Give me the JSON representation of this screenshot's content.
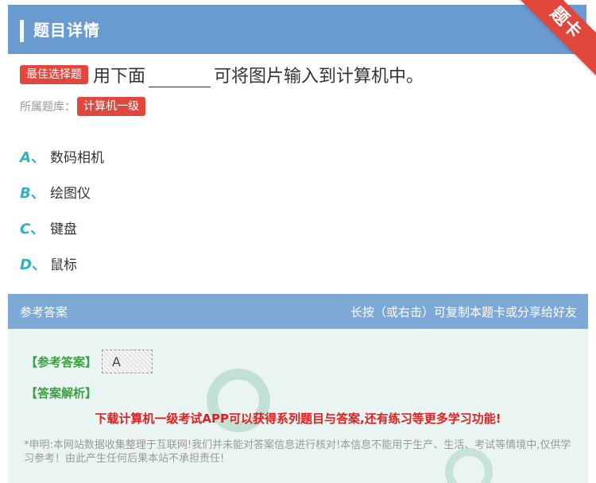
{
  "header": {
    "title": "题目详情",
    "ribbon": "题卡"
  },
  "question": {
    "type_tag": "最佳选择题",
    "text_before": "用下面",
    "text_after": "可将图片输入到计算机中。",
    "source_label": "所属题库：",
    "source_tag": "计算机一级"
  },
  "options": [
    {
      "letter": "A",
      "sep": "、",
      "text": "数码相机"
    },
    {
      "letter": "B",
      "sep": "、",
      "text": "绘图仪"
    },
    {
      "letter": "C",
      "sep": "、",
      "text": "键盘"
    },
    {
      "letter": "D",
      "sep": "、",
      "text": "鼠标"
    }
  ],
  "answer": {
    "head_left": "参考答案",
    "head_right": "长按（或右击）可复制本题卡或分享给好友",
    "ref_label": "【参考答案】",
    "ref_value": "A",
    "analysis_label": "【答案解析】",
    "promo": "下载计算机一级考试APP可以获得系列题目与答案,还有练习等更多学习功能!",
    "disclaimer": "*申明:本网站数据收集整理于互联网!我们并未能对答案信息进行核对!本信息不能用于生产、生活、考试等情境中,仅供学习参考！由此产生任何后果本站不承担责任!"
  },
  "colors": {
    "header": "#6a9bd0",
    "tag": "#e2473d",
    "option_letter": "#2fb0c5",
    "answer_label": "#3aa040",
    "promo": "#e02020"
  }
}
